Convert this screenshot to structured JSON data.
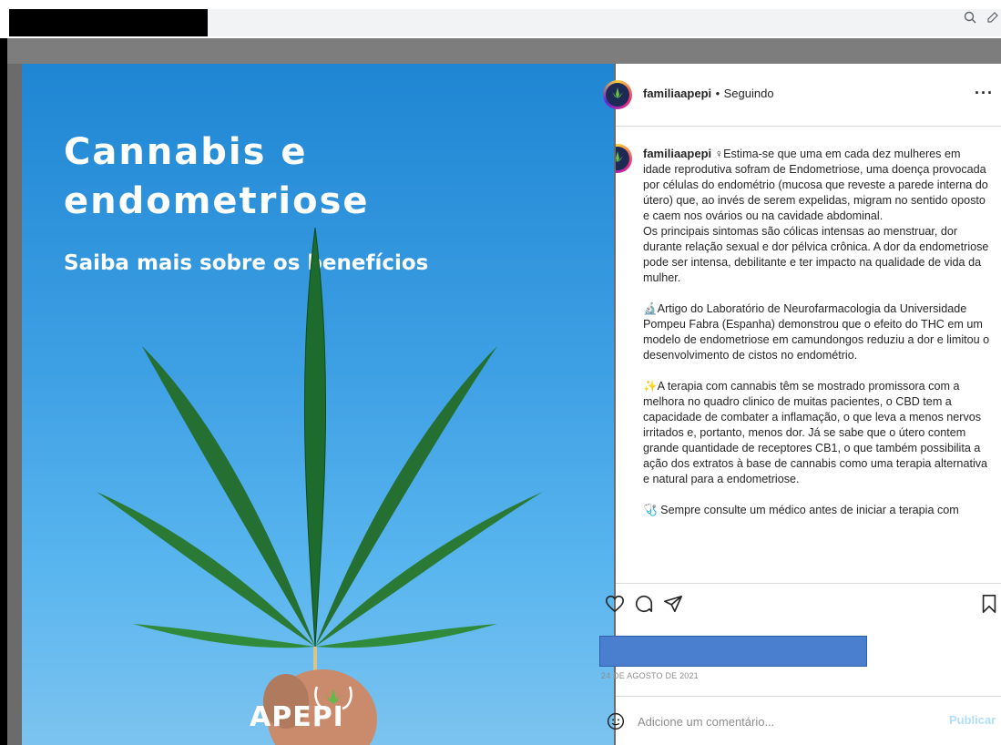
{
  "browser": {
    "zoom_icon": "zoom-icon",
    "edit_icon": "edit-icon"
  },
  "post_image": {
    "title_line1": "Cannabis e",
    "title_line2": "endometriose",
    "subtitle": "Saiba mais sobre os benefícios",
    "brand": "APEPI"
  },
  "header": {
    "username": "familiaapepi",
    "separator": "•",
    "follow_status": "Seguindo",
    "more_icon": "more-icon"
  },
  "caption": {
    "username": "familiaapepi",
    "text": "♀Estima-se que uma em cada dez mulheres em idade reprodutiva sofram de Endometriose, uma doença provocada por células do endométrio (mucosa que reveste a parede interna do útero) que, ao invés de serem expelidas, migram no sentido oposto e caem nos ovários ou na cavidade abdominal.\nOs principais sintomas são cólicas intensas ao menstruar, dor durante relação sexual e dor pélvica crônica. A dor da endometriose pode ser intensa, debilitante e ter impacto na qualidade de vida da mulher.\n\n🔬Artigo do Laboratório de Neurofarmacologia da Universidade Pompeu Fabra (Espanha) demonstrou que o efeito do THC em um modelo de endometriose em camundongos reduziu a dor e limitou o desenvolvimento de cistos no endométrio.\n\n✨A terapia com cannabis têm se mostrado promissora com a melhora no quadro clinico de muitas pacientes, o CBD tem a capacidade de combater a inflamação, o que leva a menos nervos irritados e, portanto, menos dor. Já se sabe que o útero contem grande quantidade de receptores CB1, o que também possibilita a ação dos extratos à base de cannabis como uma terapia alternativa e natural para a endometriose.\n\n🩺 Sempre consulte um médico antes de iniciar a terapia com"
  },
  "actions": {
    "like_icon": "heart-icon",
    "comment_icon": "comment-icon",
    "share_icon": "share-icon",
    "save_icon": "bookmark-icon"
  },
  "date": "24 DE AGOSTO DE 2021",
  "comment": {
    "emoji_icon": "emoji-icon",
    "placeholder": "Adicione um comentário...",
    "publish_label": "Publicar"
  },
  "colors": {
    "accent": "#0095f6",
    "publish_disabled": "#b2dffc",
    "image_blue": "#2e93dc"
  }
}
